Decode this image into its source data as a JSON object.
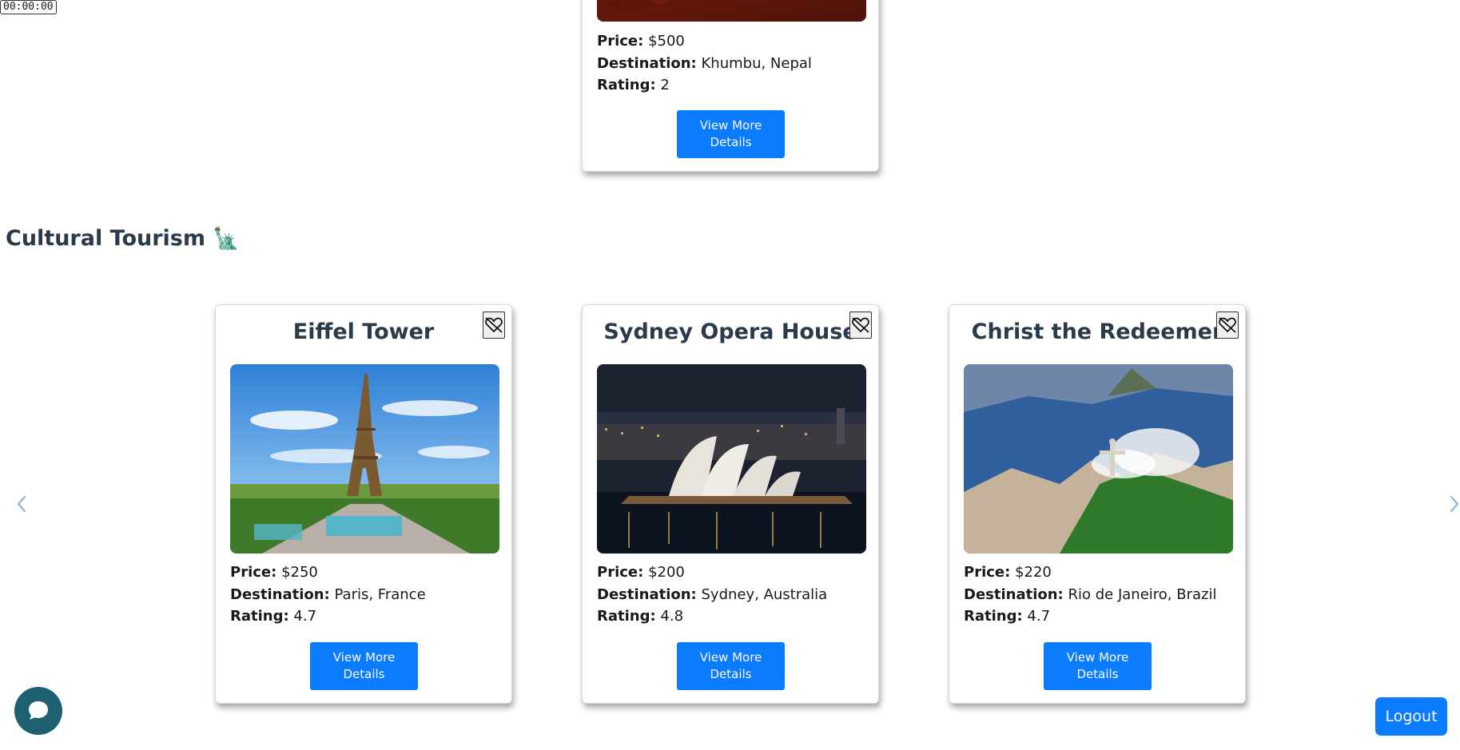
{
  "timer": "00:00:00",
  "labels": {
    "price": "Price:",
    "destination": "Destination:",
    "rating": "Rating:"
  },
  "top_card": {
    "price": "$500",
    "destination": "Khumbu, Nepal",
    "rating": "2",
    "button": "View More Details"
  },
  "section": {
    "title": "Cultural Tourism 🗽"
  },
  "cards": [
    {
      "title": "Eiffel Tower",
      "price": "$250",
      "destination": "Paris, France",
      "rating": "4.7",
      "button": "View More Details"
    },
    {
      "title": "Sydney Opera House",
      "price": "$200",
      "destination": "Sydney, Australia",
      "rating": "4.8",
      "button": "View More Details"
    },
    {
      "title": "Christ the Redeemer",
      "price": "$220",
      "destination": "Rio de Janeiro, Brazil",
      "rating": "4.7",
      "button": "View More Details"
    }
  ],
  "logout": "Logout",
  "icons": {
    "favorite": "heart-crossed-icon",
    "prev": "chevron-left-icon",
    "next": "chevron-right-icon",
    "chat": "chat-bubble-icon"
  },
  "colors": {
    "accent": "#0b7bff",
    "title": "#2b3a4a",
    "chat": "#1f5f72"
  }
}
